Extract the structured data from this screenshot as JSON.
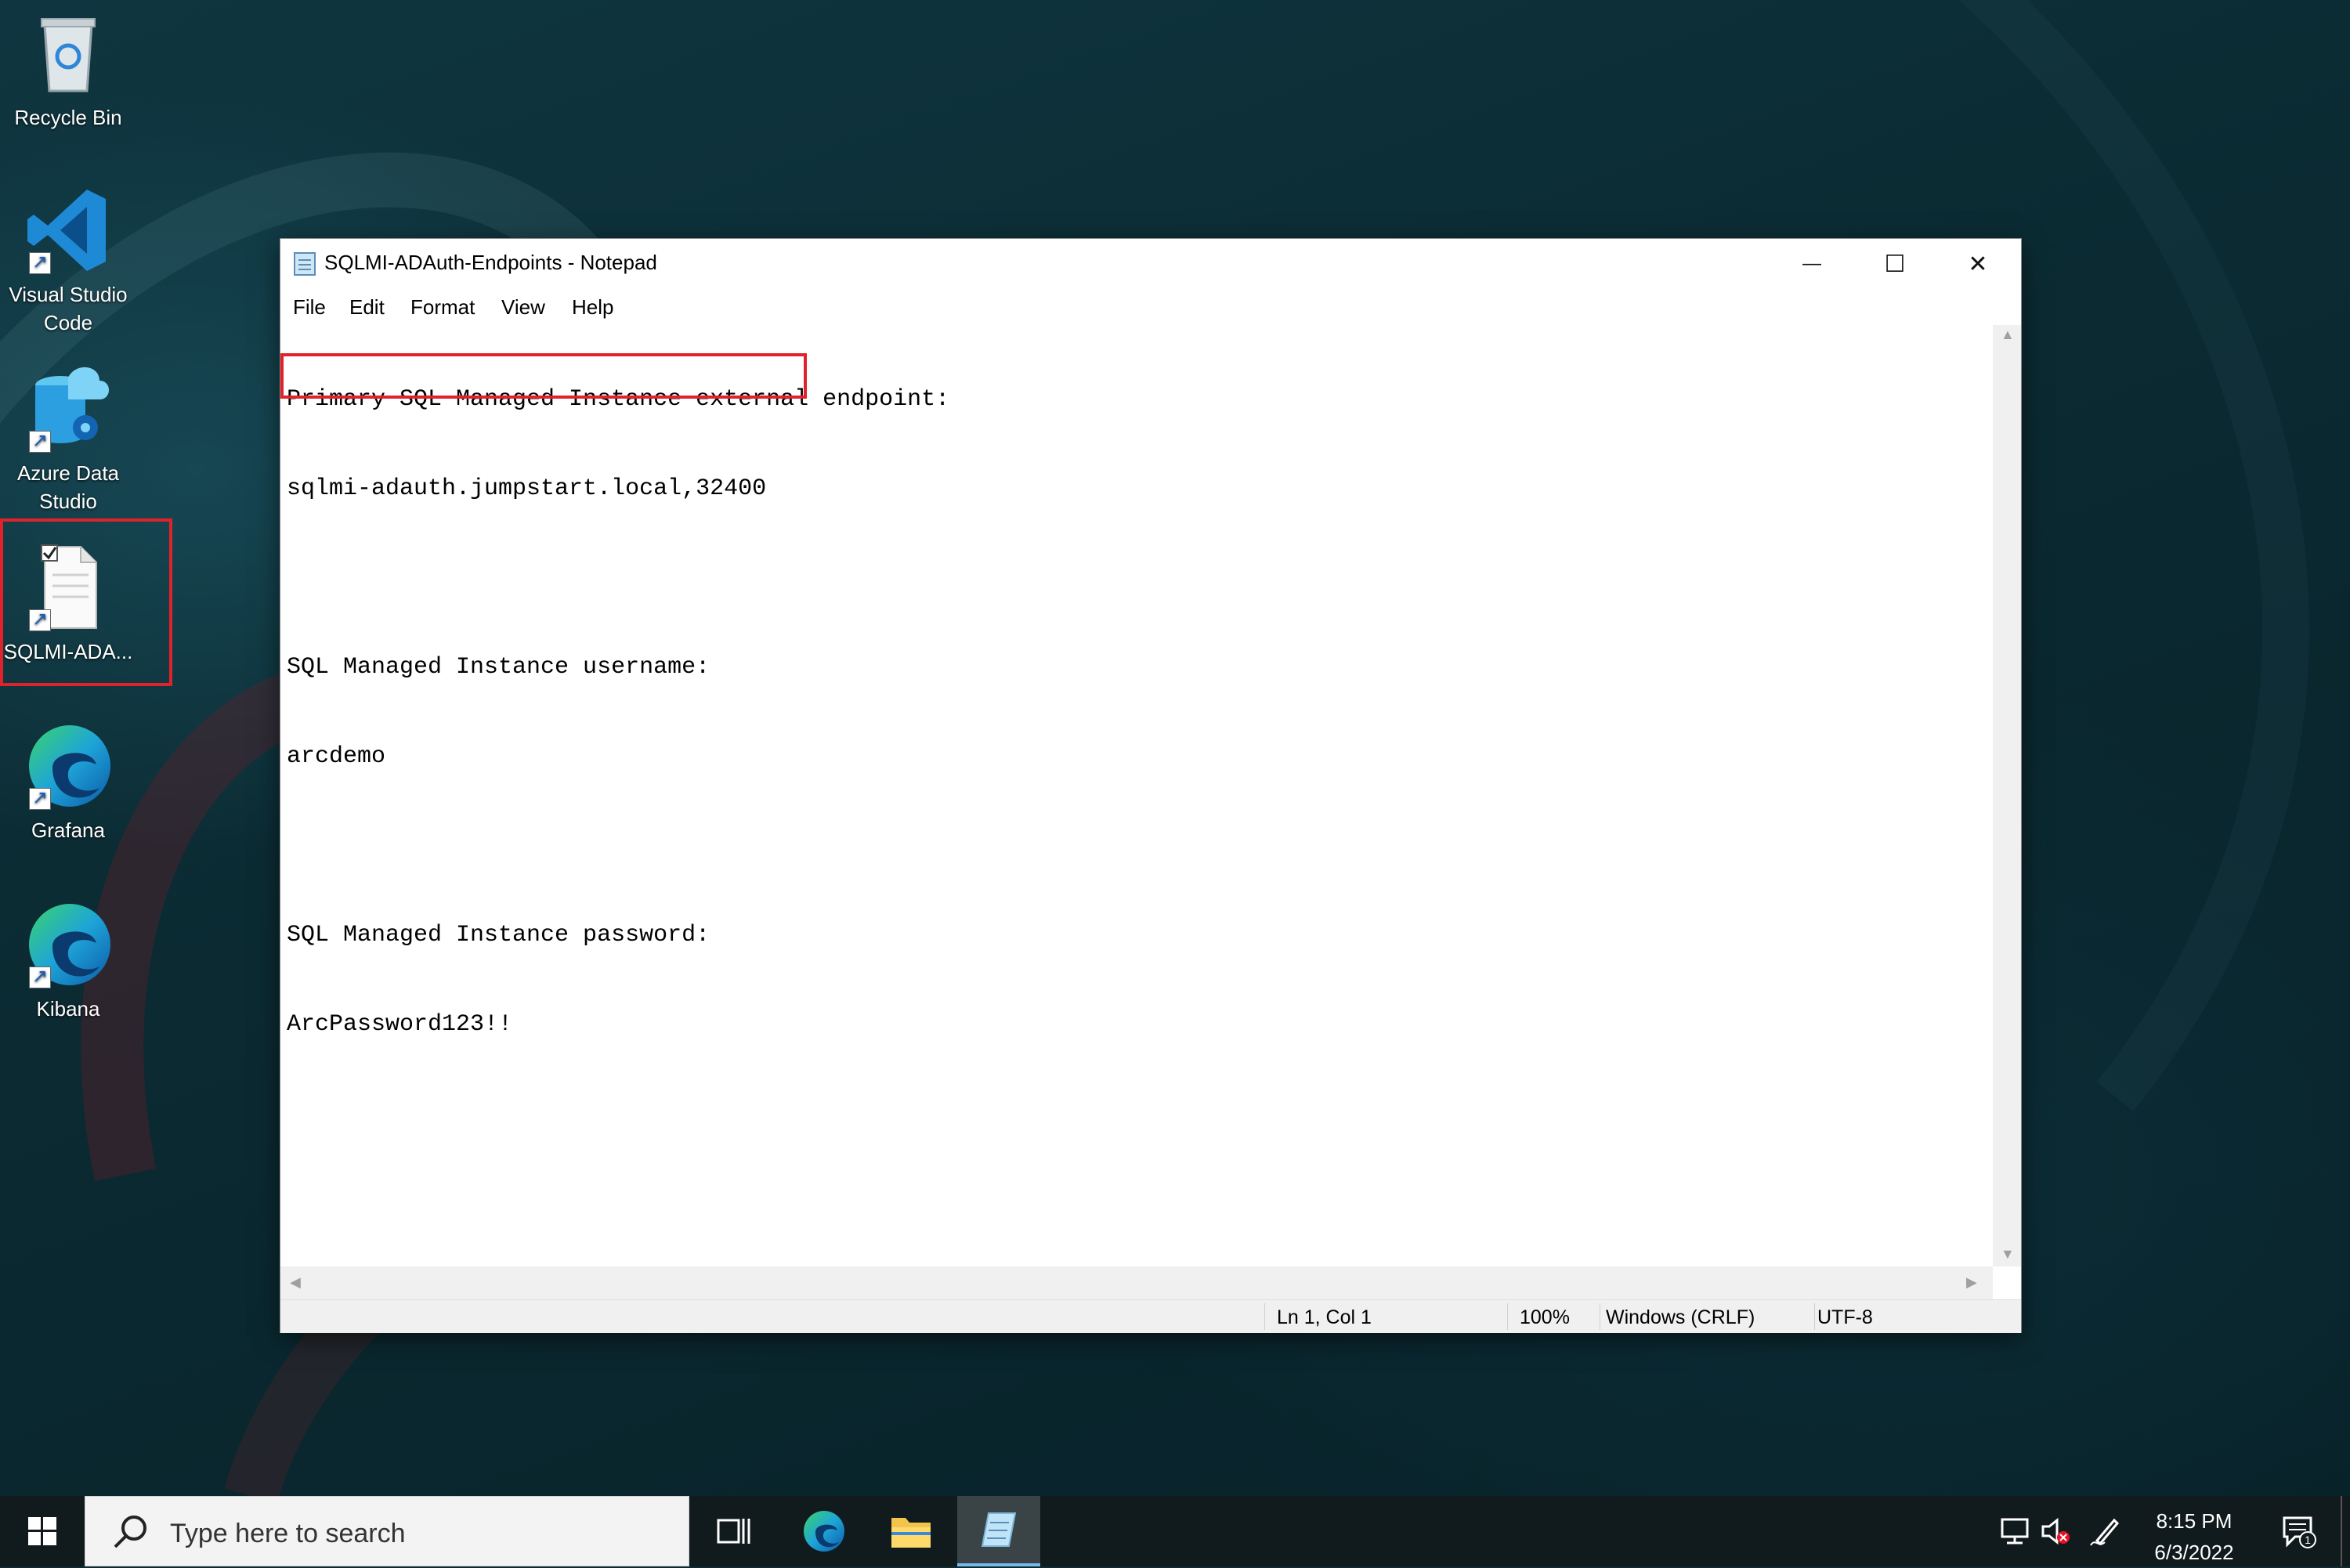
{
  "desktop": {
    "icons": [
      {
        "label": "Recycle Bin"
      },
      {
        "label": "Visual Studio Code"
      },
      {
        "label": "Azure Data Studio"
      },
      {
        "label": "SQLMI-ADA..."
      },
      {
        "label": "Grafana"
      },
      {
        "label": "Kibana"
      }
    ]
  },
  "window": {
    "title": "SQLMI-ADAuth-Endpoints - Notepad",
    "controls": {
      "minimize": "—",
      "maximize": "☐",
      "close": "✕"
    },
    "menu": [
      "File",
      "Edit",
      "Format",
      "View",
      "Help"
    ],
    "content_lines": [
      "Primary SQL Managed Instance external endpoint:",
      "sqlmi-adauth.jumpstart.local,32400",
      "",
      "SQL Managed Instance username:",
      "arcdemo",
      "",
      "SQL Managed Instance password:",
      "ArcPassword123!!"
    ],
    "status": {
      "position": "Ln 1, Col 1",
      "zoom": "100%",
      "line_ending": "Windows (CRLF)",
      "encoding": "UTF-8"
    }
  },
  "taskbar": {
    "search_placeholder": "Type here to search",
    "time": "8:15 PM",
    "date": "6/3/2022",
    "notification_count": "1"
  },
  "colors": {
    "highlight": "#e0232a",
    "taskbar": "#111a1c",
    "active_indicator": "#76b9ed"
  }
}
